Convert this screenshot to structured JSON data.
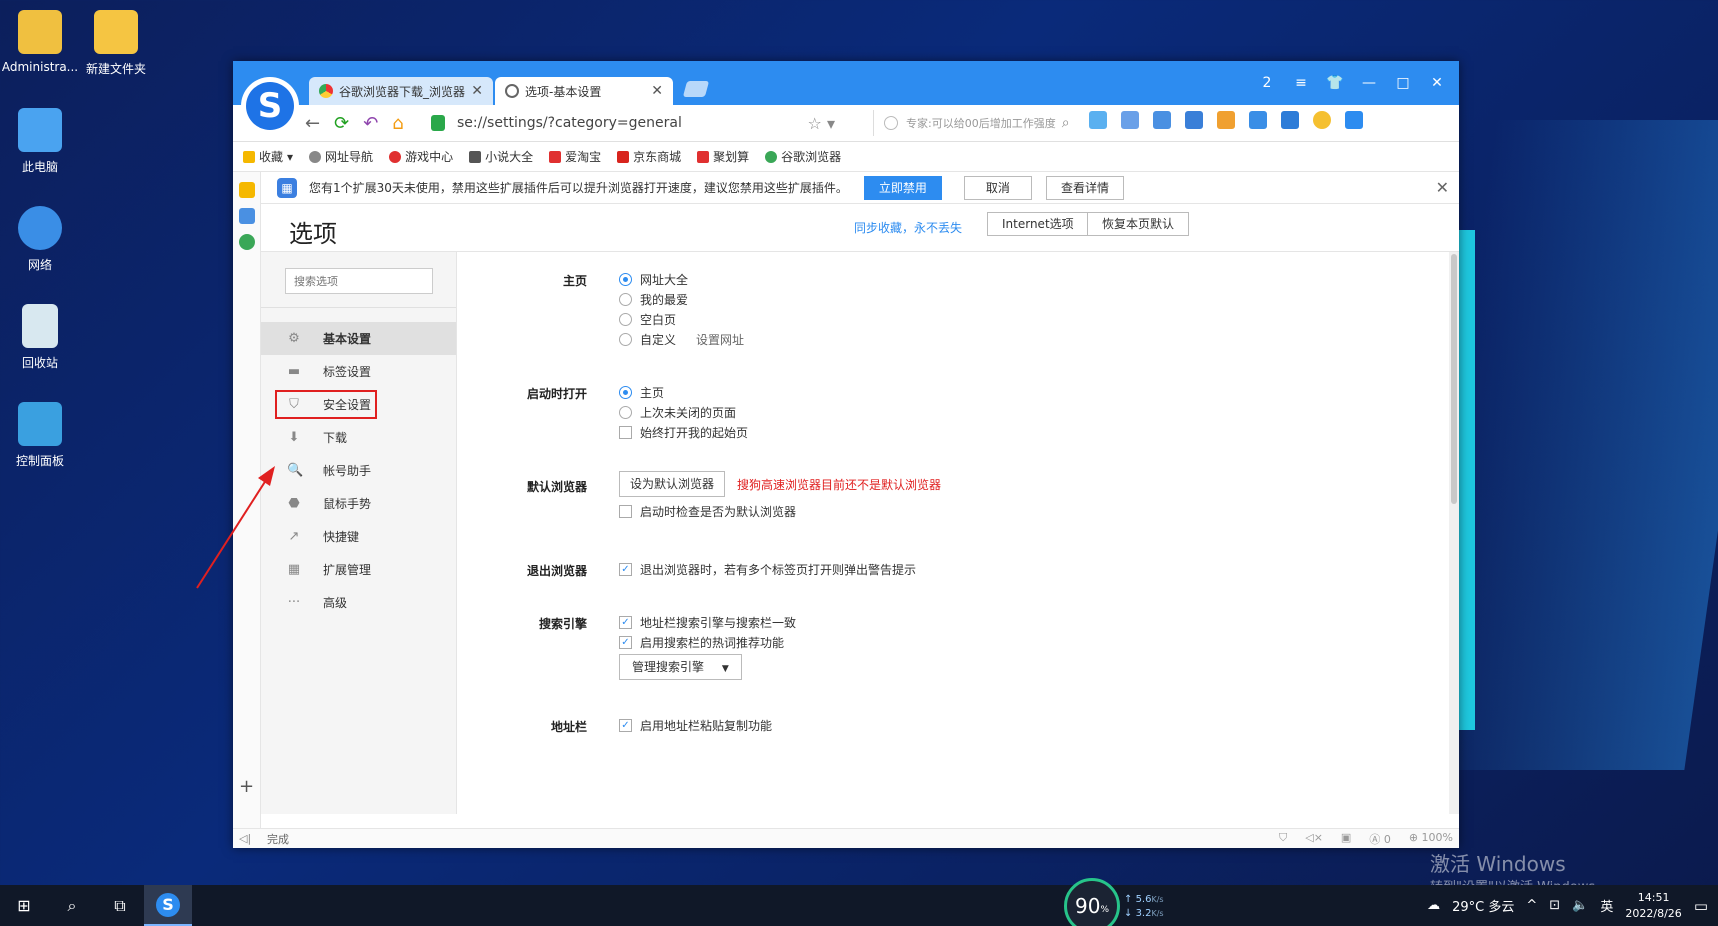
{
  "desktop": {
    "icons": [
      {
        "label": "Administra...",
        "color": "#f0c040"
      },
      {
        "label": "新建文件夹",
        "color": "#f5c542"
      },
      {
        "label": "此电脑",
        "color": "#4aa3f0"
      },
      {
        "label": "网络",
        "color": "#3a8ee6"
      },
      {
        "label": "回收站",
        "color": "#d8e8f0"
      },
      {
        "label": "控制面板",
        "color": "#3aa0e0"
      }
    ],
    "watermark_title": "激活 Windows",
    "watermark_sub": "转到\"设置\"以激活 Windows。"
  },
  "browser": {
    "tabs": [
      {
        "label": "谷歌浏览器下载_浏览器",
        "active": false
      },
      {
        "label": "选项-基本设置",
        "active": true
      }
    ],
    "window_controls": [
      "2",
      "≡",
      "👕",
      "—",
      "□",
      "✕"
    ],
    "url": "se://settings/?category=general",
    "search_placeholder": "专家:可以给00后增加工作强度",
    "bookmarks": [
      {
        "label": "收藏",
        "color": "#f5b800"
      },
      {
        "label": "网址导航",
        "color": "#888"
      },
      {
        "label": "游戏中心",
        "color": "#e03030"
      },
      {
        "label": "小说大全",
        "color": "#555"
      },
      {
        "label": "爱淘宝",
        "color": "#e03030"
      },
      {
        "label": "京东商城",
        "color": "#d8241d"
      },
      {
        "label": "聚划算",
        "color": "#e03030"
      },
      {
        "label": "谷歌浏览器",
        "color": "#3aa757"
      }
    ],
    "notice": {
      "text": "您有1个扩展30天未使用，禁用这些扩展插件后可以提升浏览器打开速度，建议您禁用这些扩展插件。",
      "disable_btn": "立即禁用",
      "cancel_btn": "取消",
      "details_btn": "查看详情"
    },
    "status_text": "完成",
    "zoom": "100%",
    "status_count": "0"
  },
  "options": {
    "title": "选项",
    "sync_link": "同步收藏，永不丢失",
    "internet_btn": "Internet选项",
    "restore_btn": "恢复本页默认",
    "search_placeholder": "搜索选项",
    "menu": [
      {
        "label": "基本设置",
        "icon": "⚙"
      },
      {
        "label": "标签设置",
        "icon": "▬"
      },
      {
        "label": "安全设置",
        "icon": "⛉"
      },
      {
        "label": "下载",
        "icon": "⬇"
      },
      {
        "label": "帐号助手",
        "icon": "🔍"
      },
      {
        "label": "鼠标手势",
        "icon": "⬣"
      },
      {
        "label": "快捷键",
        "icon": "↗"
      },
      {
        "label": "扩展管理",
        "icon": "▦"
      },
      {
        "label": "高级",
        "icon": "···"
      }
    ],
    "sections": {
      "homepage": {
        "title": "主页",
        "opts": [
          "网址大全",
          "我的最爱",
          "空白页",
          "自定义"
        ],
        "set_url": "设置网址"
      },
      "startup": {
        "title": "启动时打开",
        "opts": [
          "主页",
          "上次未关闭的页面",
          "始终打开我的起始页"
        ]
      },
      "default_browser": {
        "title": "默认浏览器",
        "btn": "设为默认浏览器",
        "warn": "搜狗高速浏览器目前还不是默认浏览器",
        "check": "启动时检查是否为默认浏览器"
      },
      "exit": {
        "title": "退出浏览器",
        "check": "退出浏览器时，若有多个标签页打开则弹出警告提示"
      },
      "search": {
        "title": "搜索引擎",
        "check1": "地址栏搜索引擎与搜索栏一致",
        "check2": "启用搜索栏的热词推荐功能",
        "manage": "管理搜索引擎"
      },
      "addressbar": {
        "title": "地址栏",
        "check": "启用地址栏粘贴复制功能"
      }
    }
  },
  "taskbar": {
    "gauge": "90",
    "gauge_unit": "%",
    "up": "5.6",
    "down": "3.2",
    "speed_unit": "K/s",
    "weather": "29°C 多云",
    "ime": "英",
    "time": "14:51",
    "date": "2022/8/26"
  }
}
